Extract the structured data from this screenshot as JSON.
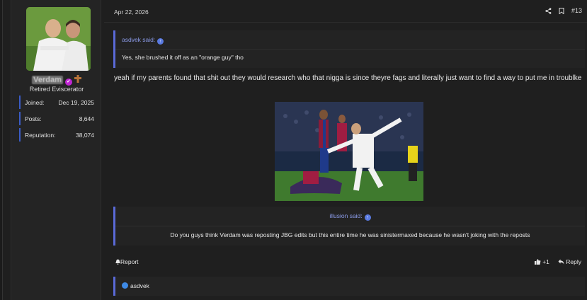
{
  "user": {
    "name": "Verdam",
    "title": "Retired Eviscerator",
    "stats": [
      {
        "label": "Joined:",
        "value": "Dec 19, 2025"
      },
      {
        "label": "Posts:",
        "value": "8,644"
      },
      {
        "label": "Reputation:",
        "value": "38,074"
      }
    ]
  },
  "post": {
    "date": "Apr 22, 2026",
    "number": "#13",
    "quote1": {
      "author": "asdvek said:",
      "text": "Yes, she brushed it off as an \"orange guy\" tho"
    },
    "message": "yeah if my parents found that shit out they would research who that nigga is since theyre fags and literally just want to find a way to put me in troublke",
    "quote2": {
      "author": "illusion said:",
      "text": "Do you guys think Verdam was reposting JBG edits but this entire time he was sinistermaxed because he wasn't joking with the reposts"
    },
    "report_label": "Report",
    "like_label": "+1",
    "reply_label": "Reply",
    "reactions": "asdvek"
  },
  "colors": {
    "accent": "#5a6ad8",
    "quote_author": "#8b9be8",
    "badge": "#c026d3"
  }
}
